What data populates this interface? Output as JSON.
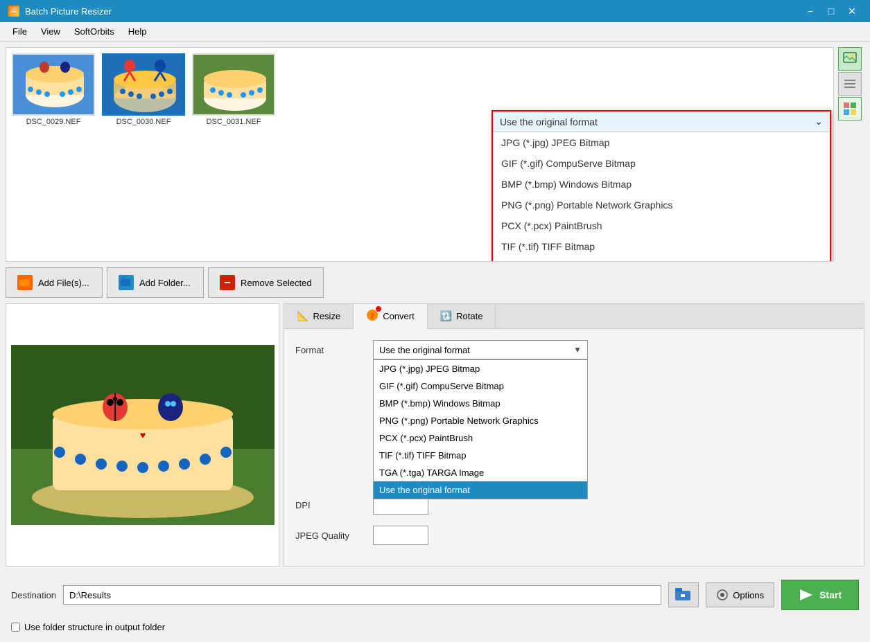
{
  "app": {
    "title": "Batch Picture Resizer",
    "icon": "🖼"
  },
  "titlebar": {
    "minimize": "−",
    "maximize": "□",
    "close": "✕"
  },
  "menu": {
    "items": [
      "File",
      "View",
      "SoftOrbits",
      "Help"
    ]
  },
  "images": [
    {
      "id": "DSC_0029",
      "label": "DSC_0029.NEF",
      "selected": false,
      "color": "#4a90d9"
    },
    {
      "id": "DSC_0030",
      "label": "DSC_0030.NEF",
      "selected": true,
      "color": "#e57373"
    },
    {
      "id": "DSC_0031",
      "label": "DSC_0031.NEF",
      "selected": false,
      "color": "#81c784"
    }
  ],
  "toolbar": {
    "add_files_label": "Add File(s)...",
    "add_folder_label": "Add Folder...",
    "remove_selected_label": "Remove Selected"
  },
  "tabs": [
    {
      "id": "resize",
      "label": "Resize",
      "icon": "📐"
    },
    {
      "id": "convert",
      "label": "Convert",
      "icon": "🔄"
    },
    {
      "id": "rotate",
      "label": "Rotate",
      "icon": "🔃"
    }
  ],
  "convert": {
    "format_label": "Format",
    "dpi_label": "DPI",
    "jpeg_quality_label": "JPEG Quality",
    "format_selected": "Use the original format",
    "format_options": [
      "JPG (*.jpg) JPEG Bitmap",
      "GIF (*.gif) CompuServe Bitmap",
      "BMP (*.bmp) Windows Bitmap",
      "PNG (*.png) Portable Network Graphics",
      "PCX (*.pcx) PaintBrush",
      "TIF (*.tif) TIFF Bitmap",
      "TGA (*.tga) TARGA Image",
      "Use the original format"
    ],
    "dpi_value": "",
    "jpeg_quality_value": ""
  },
  "big_dropdown": {
    "title": "Use the original format",
    "options": [
      "JPG (*.jpg) JPEG Bitmap",
      "GIF (*.gif) CompuServe Bitmap",
      "BMP (*.bmp) Windows Bitmap",
      "PNG (*.png) Portable Network Graphics",
      "PCX (*.pcx) PaintBrush",
      "TIF (*.tif) TIFF Bitmap",
      "TGA (*.tga) TARGA Image",
      "Use the original format"
    ],
    "selected": "Use the original format"
  },
  "destination": {
    "label": "Destination",
    "path": "D:\\Results",
    "folder_structure_label": "Use folder structure in output folder"
  },
  "buttons": {
    "options_label": "Options",
    "start_label": "Start"
  },
  "sidebar_icons": [
    "🖼",
    "☰",
    "⊞"
  ]
}
